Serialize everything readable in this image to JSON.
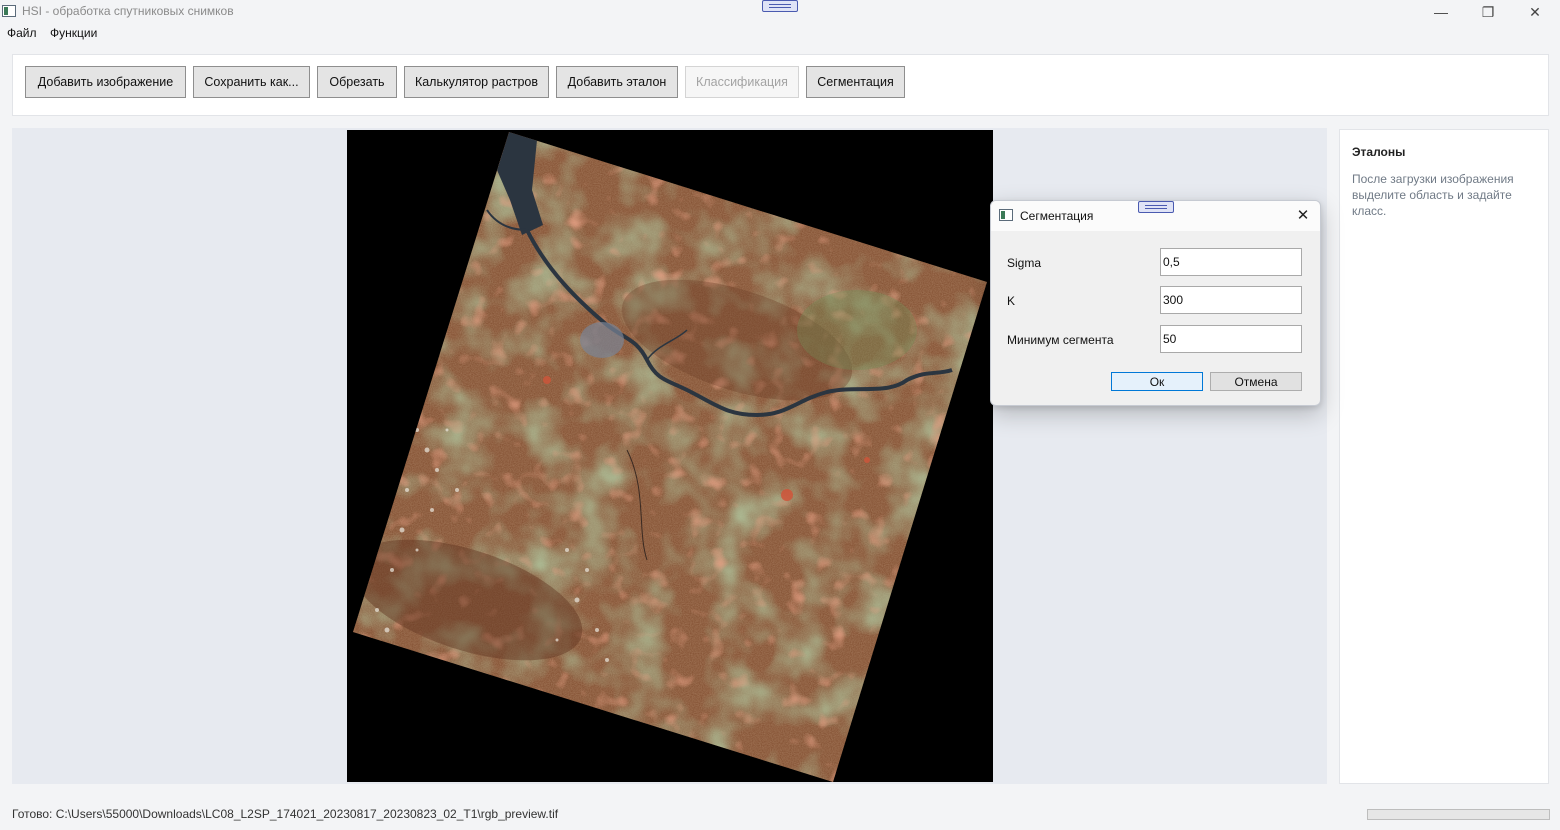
{
  "window": {
    "title": "HSI - обработка спутниковых снимков",
    "minimize_glyph": "—",
    "maximize_glyph": "❐",
    "close_glyph": "✕"
  },
  "menu": [
    "Файл",
    "Функции"
  ],
  "toolbar": {
    "add_image": "Добавить изображение",
    "save_as": "Сохранить как...",
    "crop": "Обрезать",
    "raster_calc": "Калькулятор растров",
    "add_sample": "Добавить эталон",
    "classify": "Классификация",
    "segment": "Сегментация"
  },
  "side_panel": {
    "title": "Эталоны",
    "hint": "После загрузки изображения выделите область и задайте класс."
  },
  "dialog": {
    "title": "Сегментация",
    "close_glyph": "✕",
    "fields": {
      "sigma_label": "Sigma",
      "sigma_value": "0,5",
      "k_label": "K",
      "k_value": "300",
      "min_label": "Минимум сегмента",
      "min_value": "50"
    },
    "ok": "Ок",
    "cancel": "Отмена"
  },
  "status": {
    "text": "Готово: C:\\Users\\55000\\Downloads\\LC08_L2SP_174021_20230817_20230823_02_T1\\rgb_preview.tif",
    "progress": 0
  },
  "colors": {
    "terrain_brown": "#7e4a2c",
    "vegetation_green": "#6f8f56",
    "water": "#2b3540",
    "fields_red": "#c85a3a",
    "accent": "#0078d7"
  }
}
